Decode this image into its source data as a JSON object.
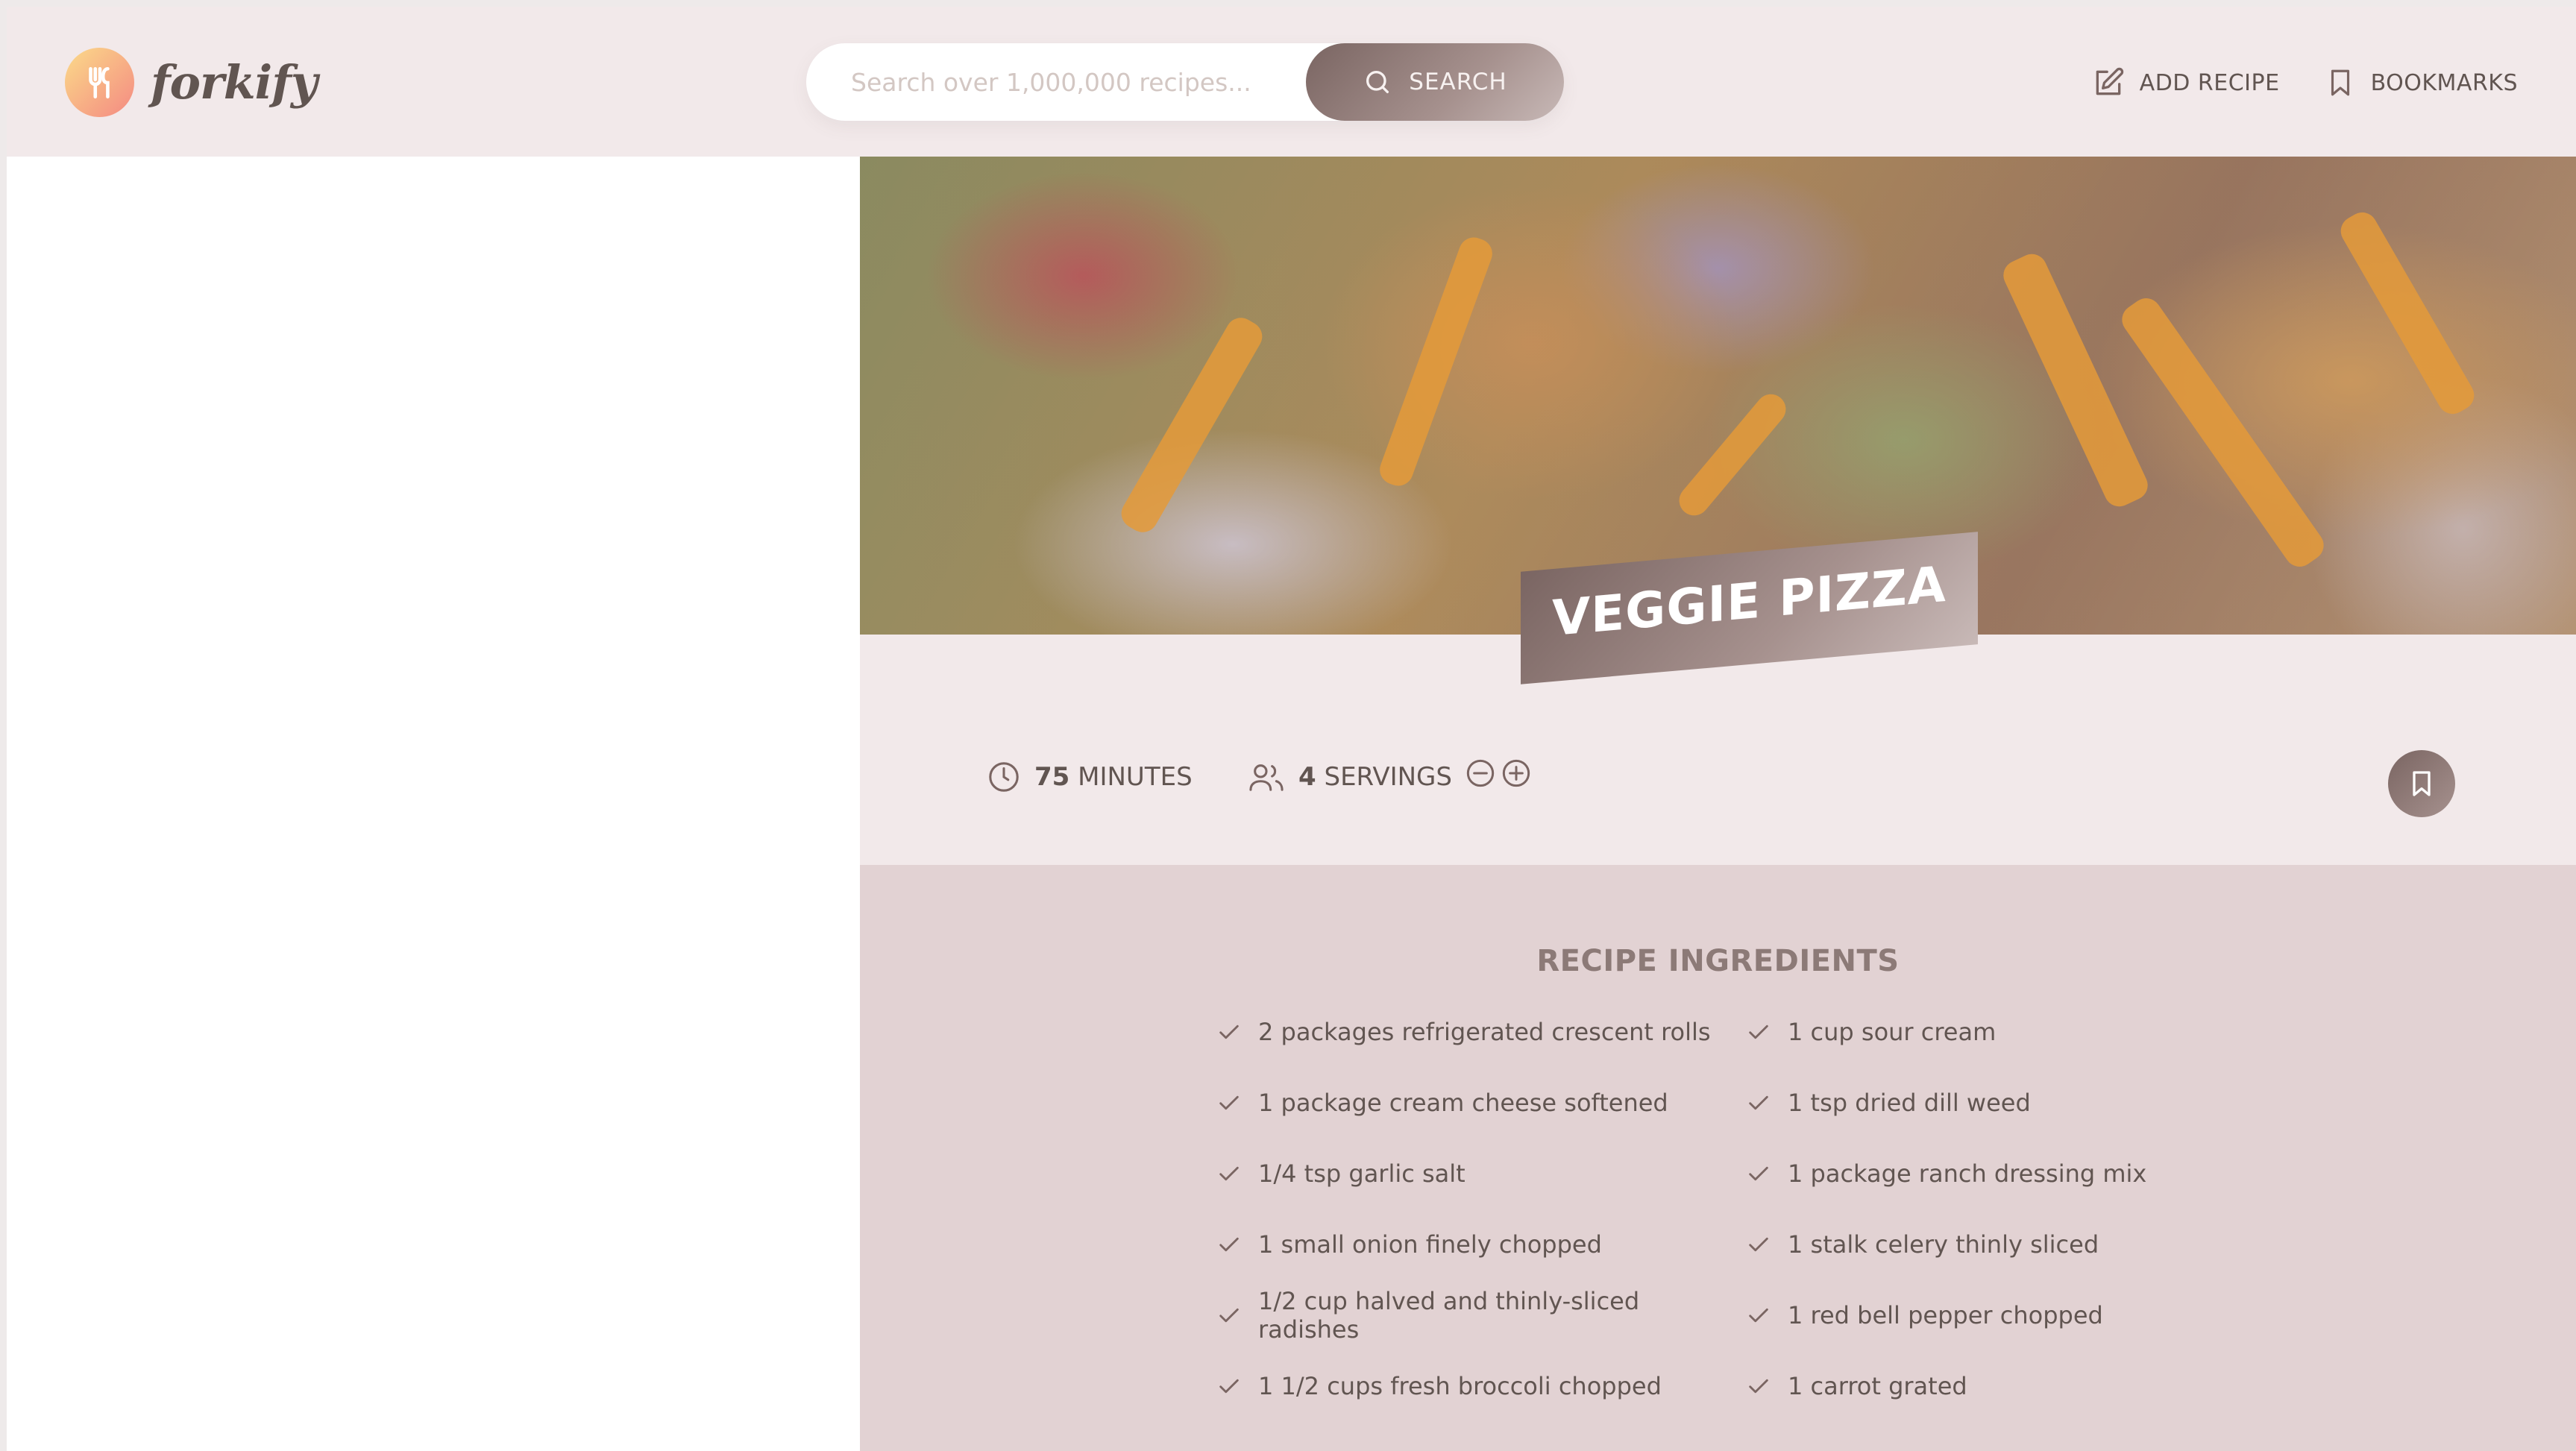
{
  "header": {
    "logo_text": "forkify",
    "search_placeholder": "Search over 1,000,000 recipes...",
    "search_value": "",
    "search_label": "SEARCH",
    "nav": {
      "add_recipe": "ADD RECIPE",
      "bookmarks": "BOOKMARKS"
    }
  },
  "recipe": {
    "title": "VEGGIE PIZZA",
    "cooking_time": "75",
    "cooking_time_unit": "MINUTES",
    "servings": "4",
    "servings_unit": "SERVINGS",
    "ingredients_heading": "RECIPE INGREDIENTS",
    "ingredients": [
      "2 packages refrigerated crescent rolls",
      "1 cup sour cream",
      "1 package cream cheese softened",
      "1 tsp dried dill weed",
      "1/4 tsp garlic salt",
      "1 package ranch dressing mix",
      "1 small onion finely chopped",
      "1 stalk celery thinly sliced",
      "1/2 cup halved and thinly-sliced radishes",
      "1 red bell pepper chopped",
      "1 1/2 cups fresh broccoli chopped",
      "1 carrot grated"
    ]
  },
  "colors": {
    "header_bg": "#f2e9ea",
    "accent_from": "#7a6562",
    "accent_to": "#c8b9b7",
    "ingredients_bg": "#e2d2d3",
    "text": "#615551"
  },
  "icons": {
    "logo": "fork-knife-icon",
    "search": "search-icon",
    "add_recipe": "edit-icon",
    "bookmarks": "bookmark-icon",
    "time": "clock-icon",
    "servings": "users-icon",
    "decrease": "minus-circle-icon",
    "increase": "plus-circle-icon",
    "ingredient": "check-icon"
  }
}
